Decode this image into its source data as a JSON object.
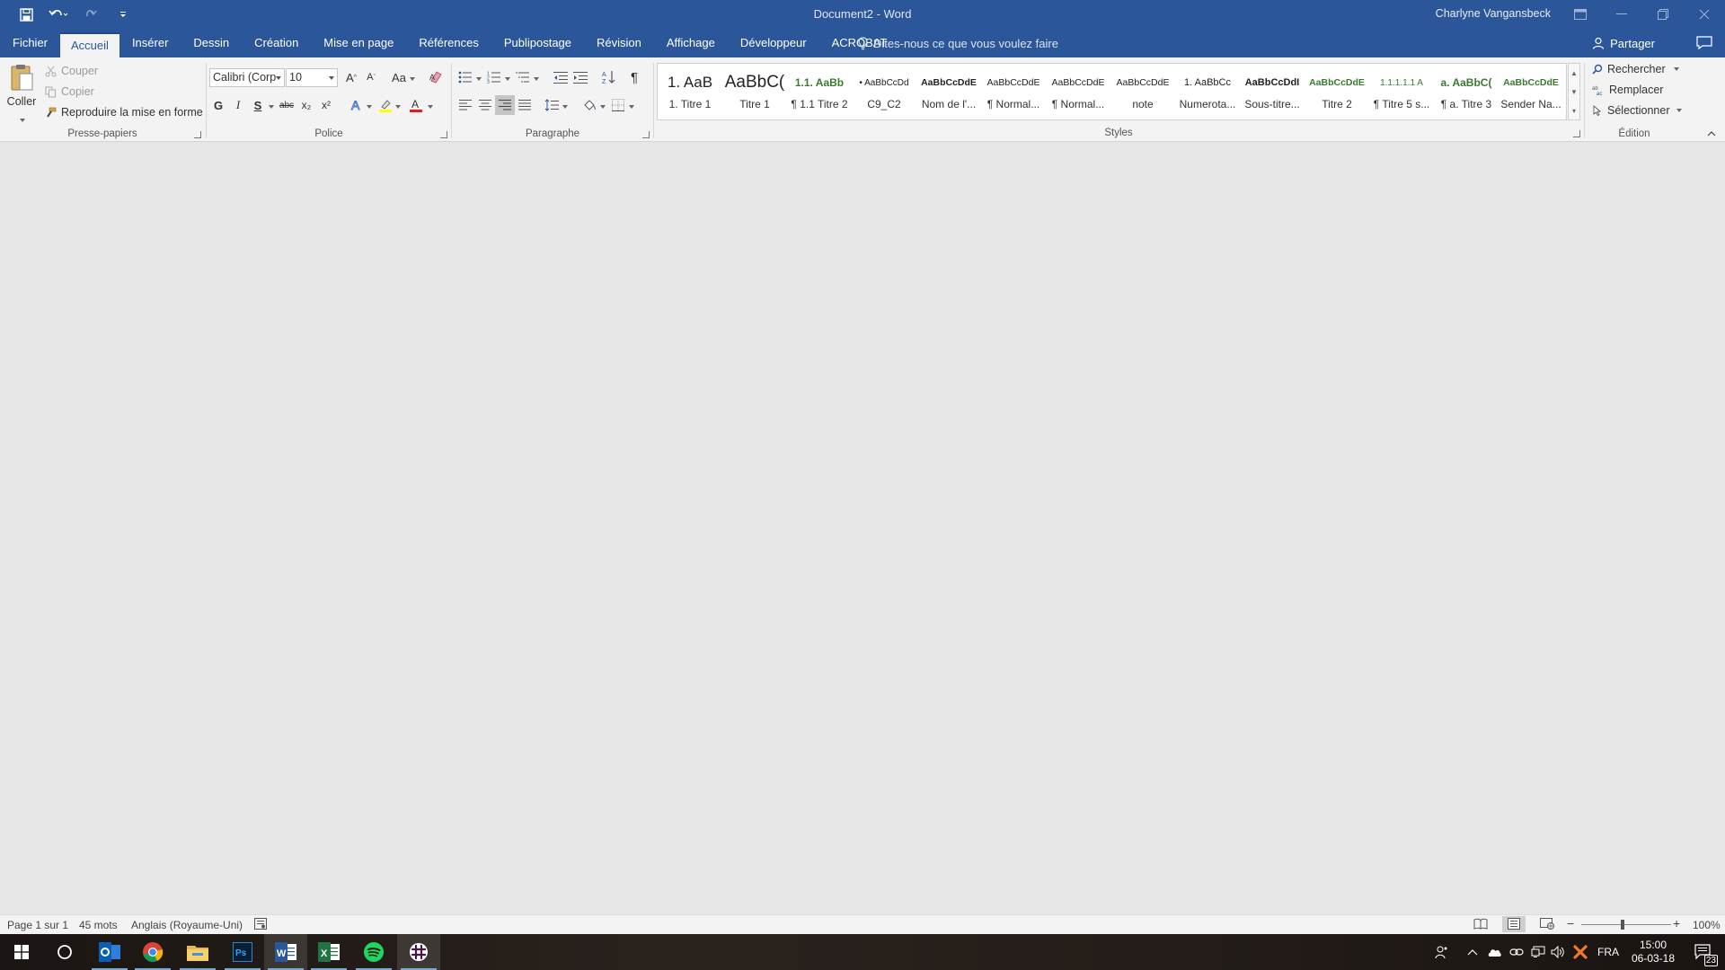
{
  "window": {
    "doc_title": "Document2  -  Word",
    "user": "Charlyne Vangansbeck"
  },
  "tabs": [
    {
      "label": "Fichier"
    },
    {
      "label": "Accueil"
    },
    {
      "label": "Insérer"
    },
    {
      "label": "Dessin"
    },
    {
      "label": "Création"
    },
    {
      "label": "Mise en page"
    },
    {
      "label": "Références"
    },
    {
      "label": "Publipostage"
    },
    {
      "label": "Révision"
    },
    {
      "label": "Affichage"
    },
    {
      "label": "Développeur"
    },
    {
      "label": "ACROBAT"
    }
  ],
  "tellme": "Dites-nous ce que vous voulez faire",
  "share": "Partager",
  "clipboard": {
    "paste": "Coller",
    "cut": "Couper",
    "copy": "Copier",
    "format_painter": "Reproduire la mise en forme",
    "label": "Presse-papiers"
  },
  "font": {
    "name": "Calibri (Corp",
    "size": "10",
    "case": "Aa",
    "bold": "G",
    "italic": "I",
    "underline": "S",
    "strike": "abc",
    "sub": "x₂",
    "sup": "x²",
    "label": "Police"
  },
  "paragraph": {
    "label": "Paragraphe",
    "pilcrow": "¶"
  },
  "styles": {
    "label": "Styles",
    "items": [
      {
        "preview": "1.  AaB",
        "name": "1. Titre 1"
      },
      {
        "preview": "AaBbC(",
        "name": "Titre 1"
      },
      {
        "preview": "1.1.  AaBb",
        "name": "¶ 1.1 Titre 2"
      },
      {
        "preview": "•  AaBbCcDd",
        "name": "C9_C2"
      },
      {
        "preview": "AaBbCcDdE",
        "name": "Nom de l'..."
      },
      {
        "preview": "AaBbCcDdE",
        "name": "¶ Normal..."
      },
      {
        "preview": "AaBbCcDdE",
        "name": "¶ Normal..."
      },
      {
        "preview": "AaBbCcDdE",
        "name": "note"
      },
      {
        "preview": "1.  AaBbCc",
        "name": "Numerota..."
      },
      {
        "preview": "AaBbCcDdI",
        "name": "Sous-titre..."
      },
      {
        "preview": "AaBbCcDdE",
        "name": "Titre 2"
      },
      {
        "preview": "1.1.1.1.1  A",
        "name": "¶ Titre 5 s..."
      },
      {
        "preview": "a.  AaBbC(",
        "name": "¶ a. Titre 3"
      },
      {
        "preview": "AaBbCcDdE",
        "name": "Sender Na..."
      }
    ]
  },
  "editing": {
    "find": "Rechercher",
    "replace": "Remplacer",
    "select": "Sélectionner",
    "label": "Édition"
  },
  "status": {
    "page": "Page 1 sur 1",
    "words": "45 mots",
    "language": "Anglais (Royaume-Uni)",
    "zoom": "100%"
  },
  "taskbar": {
    "lang": "FRA",
    "time": "15:00",
    "date": "06-03-18",
    "notifications": "23"
  },
  "colors": {
    "word_blue": "#2b579a",
    "style_green": "#3a7a2f",
    "highlight": "#ffff00",
    "font_color": "#e02020"
  }
}
